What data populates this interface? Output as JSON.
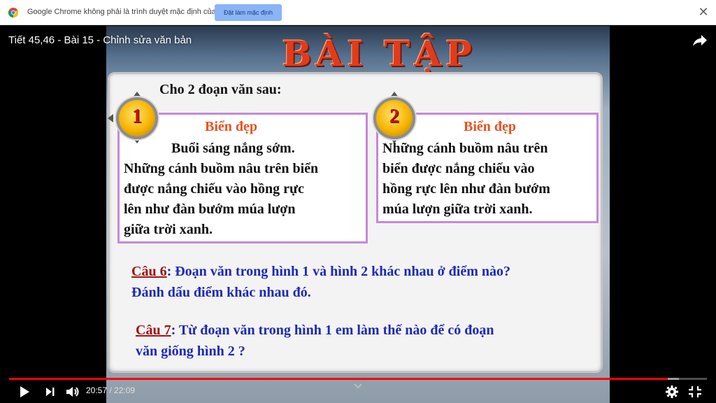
{
  "infobar": {
    "message": "Google Chrome không phải là trình duyệt mặc định của bạn",
    "button_label": "Đặt làm mặc định",
    "close_glyph": "✕",
    "icon": "chrome-logo-icon"
  },
  "player": {
    "title": "Tiết 45,46 - Bài 15 - Chỉnh sửa văn bản",
    "current_time": "20:57",
    "separator": " / ",
    "duration": "22:09",
    "progress_fraction": 0.944,
    "buffer_fraction": 0.96,
    "accent_color": "#ff0000",
    "icons": [
      "share-icon",
      "play-icon",
      "next-icon",
      "volume-icon",
      "settings-icon",
      "exit-fullscreen-icon"
    ]
  },
  "slide": {
    "heading": "BÀI TẬP",
    "intro": "Cho 2 đoạn văn sau:",
    "box1": {
      "number": "1",
      "title": "Biển đẹp",
      "lines": [
        "Buổi sáng nắng sớm.",
        "Những cánh buồm nâu trên biển",
        "được nắng chiếu vào hồng rực",
        "lên như đàn bướm múa lượn",
        "giữa trời xanh."
      ]
    },
    "box2": {
      "number": "2",
      "title": "Biển đẹp",
      "lines": [
        "Những cánh buồm nâu trên",
        "biển được nắng chiếu vào",
        "hồng rực lên như đàn bướm",
        "múa lượn giữa trời xanh."
      ]
    },
    "q6": {
      "label": "Câu 6",
      "line1": ": Đoạn văn trong hình 1 và hình 2 khác nhau ở điểm nào?",
      "line2": "Đánh dấu điểm khác nhau đó."
    },
    "q7": {
      "label": "Câu 7",
      "line1": ": Từ đoạn văn trong hình 1  em làm thế nào để có đoạn",
      "line2": "văn giống hình 2 ?"
    },
    "colors": {
      "heading": "#e23b1c",
      "box_title": "#e8541f",
      "question_text": "#1d2ab8",
      "question_label": "#a01414",
      "box_border": "#c688d9"
    }
  }
}
